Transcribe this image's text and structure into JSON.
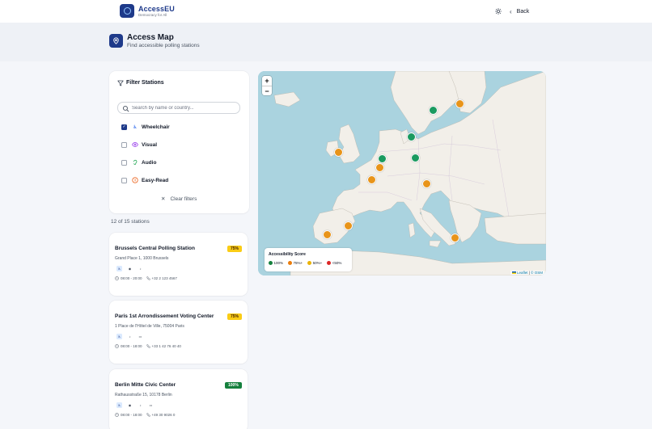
{
  "app": {
    "brand_prefix": "Access",
    "brand_suffix": "EU",
    "tagline": "Democracy for All",
    "back_label": "Back",
    "theme_icon": "sun-icon"
  },
  "hero": {
    "title": "Access Map",
    "subtitle": "Find accessible polling stations",
    "icon": "map-pin-icon"
  },
  "filters": {
    "title": "Filter Stations",
    "search_placeholder": "Search by name or country...",
    "search_value": "",
    "options": [
      {
        "label": "Wheelchair",
        "checked": true,
        "icon": "wheelchair-icon"
      },
      {
        "label": "Visual",
        "checked": false,
        "icon": "eye-icon"
      },
      {
        "label": "Audio",
        "checked": false,
        "icon": "ear-icon"
      },
      {
        "label": "Easy-Read",
        "checked": false,
        "icon": "book-icon"
      }
    ],
    "clear_label": "Clear filters"
  },
  "results": {
    "count_text": "12 of 15 stations"
  },
  "stations": [
    {
      "name": "Brussels Central Polling Station",
      "address": "Grand Place 1, 1000 Brussels",
      "score": "75%",
      "hours": "08:00 - 20:00",
      "phone": "+32 2 123 4567"
    },
    {
      "name": "Paris 1st Arrondissement Voting Center",
      "address": "1 Place de l'Hôtel de Ville, 75004 Paris",
      "score": "75%",
      "hours": "08:00 - 18:00",
      "phone": "+33 1 42 76 40 40"
    },
    {
      "name": "Berlin Mitte Civic Center",
      "address": "Rathausstraße 15, 10178 Berlin",
      "score": "100%",
      "hours": "08:00 - 18:00",
      "phone": "+49 30 9026 0"
    }
  ],
  "map": {
    "zoom_in": "+",
    "zoom_out": "−",
    "legend": {
      "title": "Accessibility Score",
      "items": [
        {
          "label": "100%",
          "color": "#15803d"
        },
        {
          "label": "75%+",
          "color": "#ea7c0c"
        },
        {
          "label": "50%+",
          "color": "#eab308"
        },
        {
          "label": "<50%",
          "color": "#dc2626"
        }
      ]
    },
    "attribution_leaflet": "Leaflet",
    "attribution_sep": "|",
    "attribution_osm": "© OSM"
  },
  "colors": {
    "primary": "#1e3a8a",
    "marker_green": "#1a9a5f",
    "marker_orange": "#e8941a"
  }
}
